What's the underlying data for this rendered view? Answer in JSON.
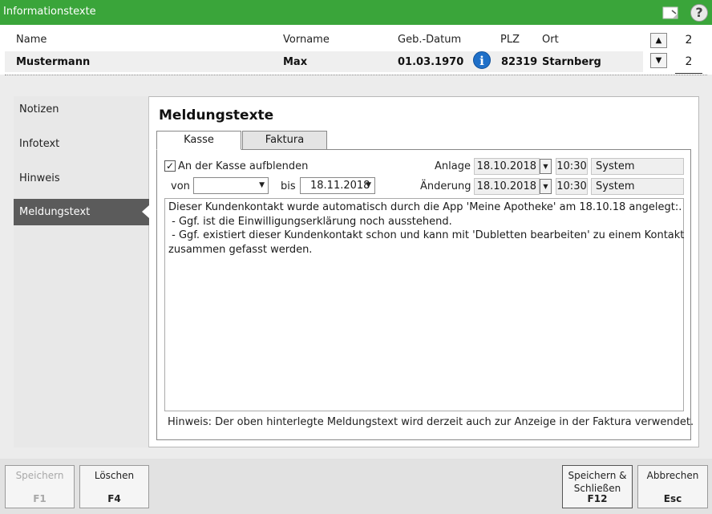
{
  "window": {
    "title": "Informationstexte"
  },
  "header": {
    "labels": {
      "name": "Name",
      "vorname": "Vorname",
      "geb": "Geb.-Datum",
      "plz": "PLZ",
      "ort": "Ort"
    },
    "values": {
      "name": "Mustermann",
      "vorname": "Max",
      "geb": "01.03.1970",
      "plz": "82319",
      "ort": "Starnberg"
    },
    "pager": {
      "current": "2",
      "total": "2"
    }
  },
  "sidebar": {
    "items": [
      {
        "label": "Notizen"
      },
      {
        "label": "Infotext"
      },
      {
        "label": "Hinweis"
      },
      {
        "label": "Meldungstext",
        "active": true
      }
    ]
  },
  "content": {
    "title": "Meldungstexte",
    "tabs": [
      {
        "label": "Kasse",
        "active": true
      },
      {
        "label": "Faktura"
      }
    ],
    "checkbox_label": "An der Kasse aufblenden",
    "checkbox_checked": true,
    "von_label": "von",
    "von_value": "",
    "bis_label": "bis",
    "bis_value": "18.11.2018",
    "anlage": {
      "label": "Anlage",
      "date": "18.10.2018",
      "time": "10:30",
      "user": "System"
    },
    "aenderung": {
      "label": "Änderung",
      "date": "18.10.2018",
      "time": "10:30",
      "user": "System"
    },
    "text_lines": [
      "Dieser Kundenkontakt wurde automatisch durch die App 'Meine Apotheke' am 18.10.18 angelegt:.",
      " - Ggf. ist die Einwilligungserklärung noch ausstehend.",
      " - Ggf. existiert dieser Kundenkontakt schon und kann mit 'Dubletten bearbeiten' zu einem Kontakt",
      "zusammen gefasst werden."
    ],
    "hint": "Hinweis: Der oben hinterlegte Meldungstext wird derzeit auch zur Anzeige in der Faktura verwendet."
  },
  "footer": {
    "save": {
      "label": "Speichern",
      "key": "F1",
      "disabled": true
    },
    "delete": {
      "label": "Löschen",
      "key": "F4"
    },
    "save_close": {
      "label_line1": "Speichern &",
      "label_line2": "Schließen",
      "key": "F12"
    },
    "cancel": {
      "label": "Abbrechen",
      "key": "Esc"
    }
  },
  "icons": {
    "note": "note-icon",
    "help": "help-icon",
    "info": "info-icon",
    "up": "arrow-up-icon",
    "down": "arrow-down-icon",
    "check": "check-icon",
    "caret": "chevron-down-icon"
  }
}
